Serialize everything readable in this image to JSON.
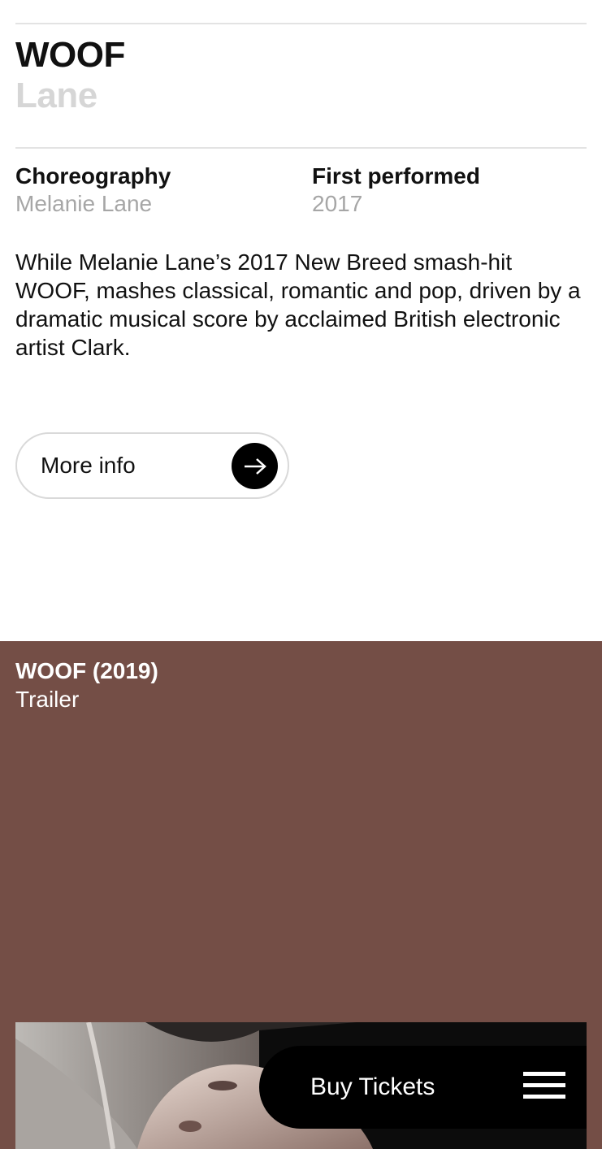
{
  "production": {
    "title": "WOOF",
    "subtitle": "Lane"
  },
  "details": {
    "choreography_label": "Choreography",
    "choreography_value": "Melanie Lane",
    "first_performed_label": "First performed",
    "first_performed_value": "2017"
  },
  "description": "While Melanie Lane’s 2017 New Breed smash-hit WOOF, mashes classical, romantic and pop, driven by a dramatic musical score by acclaimed British electronic artist Clark.",
  "more_info": {
    "label": "More info",
    "icon": "arrow-right-icon"
  },
  "video": {
    "title": "WOOF (2019)",
    "subtitle": "Trailer",
    "background_color": "#744e46"
  },
  "footer_bar": {
    "buy_label": "Buy Tickets",
    "menu_icon": "hamburger-menu-icon"
  }
}
